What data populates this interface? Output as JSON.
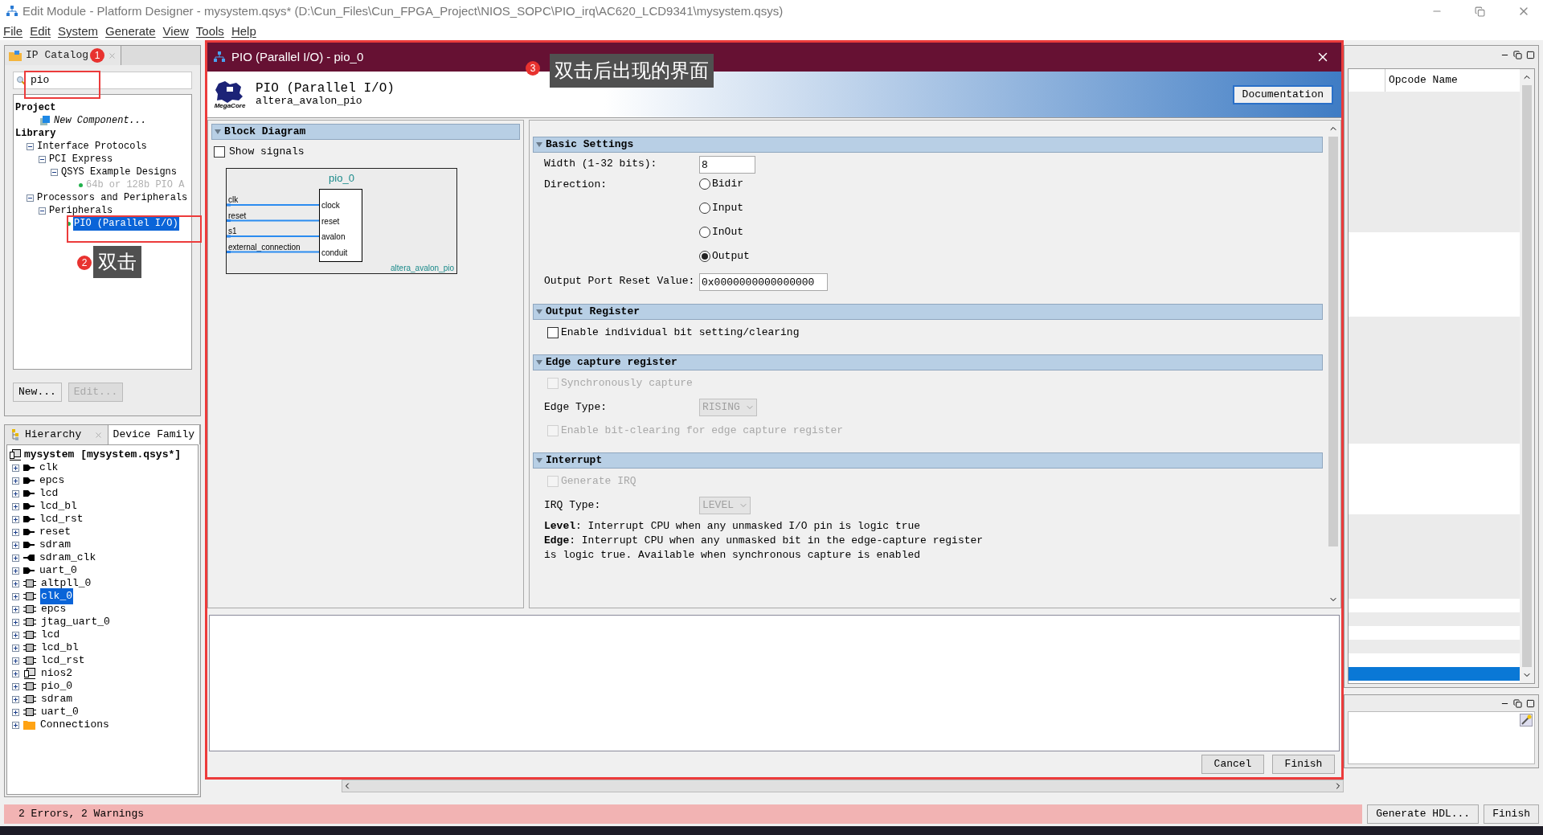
{
  "window": {
    "title": "Edit Module - Platform Designer - mysystem.qsys* (D:\\Cun_Files\\Cun_FPGA_Project\\NIOS_SOPC\\PIO_irq\\AC620_LCD9341\\mysystem.qsys)"
  },
  "menu": [
    "File",
    "Edit",
    "System",
    "Generate",
    "View",
    "Tools",
    "Help"
  ],
  "ip_catalog": {
    "tab": "IP Catalog",
    "search": {
      "value": "pio"
    },
    "tree": [
      {
        "label": "Project",
        "kind": "heading",
        "selected": false,
        "children": [
          {
            "label": "New Component...",
            "kind": "action",
            "selected": false
          }
        ]
      },
      {
        "label": "Library",
        "kind": "heading",
        "selected": false,
        "children": [
          {
            "label": "Interface Protocols",
            "kind": "category",
            "expanded": true,
            "selected": false,
            "children": [
              {
                "label": "PCI Express",
                "kind": "category",
                "expanded": true,
                "selected": false,
                "children": [
                  {
                    "label": "QSYS Example Designs",
                    "kind": "category",
                    "expanded": true,
                    "selected": false,
                    "children": [
                      {
                        "label": "64b or 128b PIO A",
                        "kind": "ip",
                        "disabled": true,
                        "selected": false
                      }
                    ]
                  }
                ]
              }
            ]
          },
          {
            "label": "Processors and Peripherals",
            "kind": "category",
            "expanded": true,
            "selected": false,
            "children": [
              {
                "label": "Peripherals",
                "kind": "category",
                "expanded": true,
                "selected": false,
                "children": [
                  {
                    "label": "PIO (Parallel I/O)",
                    "kind": "ip",
                    "disabled": false,
                    "selected": true
                  }
                ]
              }
            ]
          }
        ]
      }
    ],
    "buttons": [
      {
        "label": "New...",
        "disabled": false
      },
      {
        "label": "Edit...",
        "disabled": true
      }
    ]
  },
  "hierarchy": {
    "tabs": [
      {
        "label": "Hierarchy",
        "selected": true
      },
      {
        "label": "Device Family",
        "selected": false
      }
    ],
    "root": "mysystem [mysystem.qsys*]",
    "items": [
      {
        "label": "clk",
        "kind": "export_out",
        "expanded": false,
        "selected": false
      },
      {
        "label": "epcs",
        "kind": "export_out",
        "expanded": false,
        "selected": false
      },
      {
        "label": "lcd",
        "kind": "export_out",
        "expanded": false,
        "selected": false
      },
      {
        "label": "lcd_bl",
        "kind": "export_out",
        "expanded": false,
        "selected": false
      },
      {
        "label": "lcd_rst",
        "kind": "export_out",
        "expanded": false,
        "selected": false
      },
      {
        "label": "reset",
        "kind": "export_out",
        "expanded": false,
        "selected": false
      },
      {
        "label": "sdram",
        "kind": "export_out",
        "expanded": false,
        "selected": false
      },
      {
        "label": "sdram_clk",
        "kind": "export_in",
        "expanded": false,
        "selected": false
      },
      {
        "label": "uart_0",
        "kind": "export_out",
        "expanded": false,
        "selected": false
      },
      {
        "label": "altpll_0",
        "kind": "component",
        "expanded": false,
        "selected": false
      },
      {
        "label": "clk_0",
        "kind": "component",
        "expanded": false,
        "selected": true
      },
      {
        "label": "epcs",
        "kind": "component",
        "expanded": false,
        "selected": false
      },
      {
        "label": "jtag_uart_0",
        "kind": "component",
        "expanded": false,
        "selected": false
      },
      {
        "label": "lcd",
        "kind": "component",
        "expanded": false,
        "selected": false
      },
      {
        "label": "lcd_bl",
        "kind": "component",
        "expanded": false,
        "selected": false
      },
      {
        "label": "lcd_rst",
        "kind": "component",
        "expanded": false,
        "selected": false
      },
      {
        "label": "nios2",
        "kind": "processor",
        "expanded": false,
        "selected": false
      },
      {
        "label": "pio_0",
        "kind": "component",
        "expanded": false,
        "selected": false
      },
      {
        "label": "sdram",
        "kind": "component",
        "expanded": false,
        "selected": false
      },
      {
        "label": "uart_0",
        "kind": "component",
        "expanded": false,
        "selected": false
      },
      {
        "label": "Connections",
        "kind": "folder",
        "expanded": false,
        "selected": false
      }
    ]
  },
  "right_panel": {
    "columns": [
      "Opcode Name"
    ]
  },
  "dialog": {
    "title": "PIO (Parallel I/O) - pio_0",
    "header": {
      "logo_text": "MegaCore",
      "name": "PIO (Parallel I/O)",
      "id": "altera_avalon_pio"
    },
    "documentation": "Documentation",
    "block_diagram": {
      "title": "Block Diagram",
      "show_signals": {
        "label": "Show signals",
        "checked": false
      },
      "instance": "pio_0",
      "component": "altera_avalon_pio",
      "ports": [
        {
          "signal": "clk",
          "port": "clock"
        },
        {
          "signal": "reset",
          "port": "reset"
        },
        {
          "signal": "s1",
          "port": "avalon"
        },
        {
          "signal": "external_connection",
          "port": "conduit"
        }
      ]
    },
    "sections": [
      {
        "title": "Basic Settings",
        "fields": [
          {
            "kind": "text",
            "label": "Width (1-32 bits):",
            "value": "8"
          },
          {
            "kind": "radio",
            "label": "Direction:",
            "options": [
              {
                "label": "Bidir",
                "selected": false
              },
              {
                "label": "Input",
                "selected": false
              },
              {
                "label": "InOut",
                "selected": false
              },
              {
                "label": "Output",
                "selected": true
              }
            ]
          },
          {
            "kind": "text",
            "label": "Output Port Reset Value:",
            "value": "0x0000000000000000"
          }
        ]
      },
      {
        "title": "Output Register",
        "fields": [
          {
            "kind": "checkbox",
            "label": "Enable individual bit setting/clearing",
            "checked": false,
            "disabled": false
          }
        ]
      },
      {
        "title": "Edge capture register",
        "fields": [
          {
            "kind": "checkbox",
            "label": "Synchronously capture",
            "checked": false,
            "disabled": true
          },
          {
            "kind": "select",
            "label": "Edge Type:",
            "value": "RISING",
            "disabled": true
          },
          {
            "kind": "checkbox",
            "label": "Enable bit-clearing for edge capture register",
            "checked": false,
            "disabled": true
          }
        ]
      },
      {
        "title": "Interrupt",
        "fields": [
          {
            "kind": "checkbox",
            "label": "Generate IRQ",
            "checked": false,
            "disabled": true
          },
          {
            "kind": "select",
            "label": "IRQ Type:",
            "value": "LEVEL",
            "disabled": true
          },
          {
            "kind": "note",
            "text": "**Level**: Interrupt CPU when any unmasked I/O pin is logic true"
          },
          {
            "kind": "note",
            "text": "**Edge**: Interrupt CPU when any unmasked bit in the edge-capture register is logic true. Available when synchronous capture is enabled"
          }
        ]
      }
    ],
    "buttons": [
      "Cancel",
      "Finish"
    ]
  },
  "status_bar": {
    "text": "2 Errors, 2 Warnings",
    "buttons": [
      "Generate HDL...",
      "Finish"
    ]
  },
  "annotations": [
    {
      "number": "1"
    },
    {
      "number": "2",
      "label": "双击"
    },
    {
      "number": "3",
      "label": "双击后出现的界面"
    }
  ]
}
